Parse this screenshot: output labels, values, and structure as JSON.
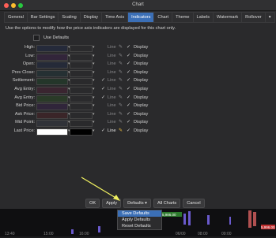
{
  "window": {
    "title": "Chart"
  },
  "tabs": [
    {
      "label": "General"
    },
    {
      "label": "Bar Settings"
    },
    {
      "label": "Scaling"
    },
    {
      "label": "Display"
    },
    {
      "label": "Time Axis"
    },
    {
      "label": "Indicators",
      "active": true
    },
    {
      "label": "Chart"
    },
    {
      "label": "Theme"
    },
    {
      "label": "Labels"
    },
    {
      "label": "Watermark"
    },
    {
      "label": "Rollover"
    }
  ],
  "tabs_more": "▾",
  "description": "Use the options to modify how the price axis indicators are displayed for this chart only.",
  "use_defaults_label": "Use Defaults",
  "rows": [
    {
      "label": "High:",
      "color": "#252a3a",
      "line_checked": false
    },
    {
      "label": "Low:",
      "color": "#32253a",
      "line_checked": false
    },
    {
      "label": "Open:",
      "color": "#252a38",
      "line_checked": false
    },
    {
      "label": "Prev Close:",
      "color": "#253033",
      "line_checked": false
    },
    {
      "label": "Settlement:",
      "color": "#24362a",
      "line_checked": true
    },
    {
      "label": "Avg Entry:",
      "color": "#3a2530",
      "line_checked": true
    },
    {
      "label": "Avg Entry:",
      "color": "#2a3a28",
      "line_checked": true
    },
    {
      "label": "Bid Price:",
      "color": "#30253a",
      "line_checked": false
    },
    {
      "label": "Ask Price:",
      "color": "#3a2528",
      "line_checked": false
    },
    {
      "label": "Mid Point:",
      "color": "#303238",
      "line_checked": false
    },
    {
      "label": "Last Price:",
      "color": "#ffffff",
      "color2": "#000000",
      "line_checked": true,
      "on": true
    }
  ],
  "line_label": "Line",
  "display_label": "Display",
  "buttons": {
    "ok": "OK",
    "apply": "Apply",
    "defaults": "Defaults ▾",
    "all_charts": "All Charts",
    "cancel": "Cancel"
  },
  "menu": [
    {
      "label": "Save Defaults",
      "selected": true
    },
    {
      "label": "Apply Defaults"
    },
    {
      "label": "Reset Defaults"
    }
  ],
  "axis_labels": [
    "13:40",
    "15:00",
    "16:00",
    "06/00",
    "08:00",
    "09:00"
  ],
  "price_tag": "5,986.00",
  "price_tag2": "5,996.00",
  "colors": {
    "accent": "#3b6fb6",
    "arrow": "#f0f060"
  }
}
